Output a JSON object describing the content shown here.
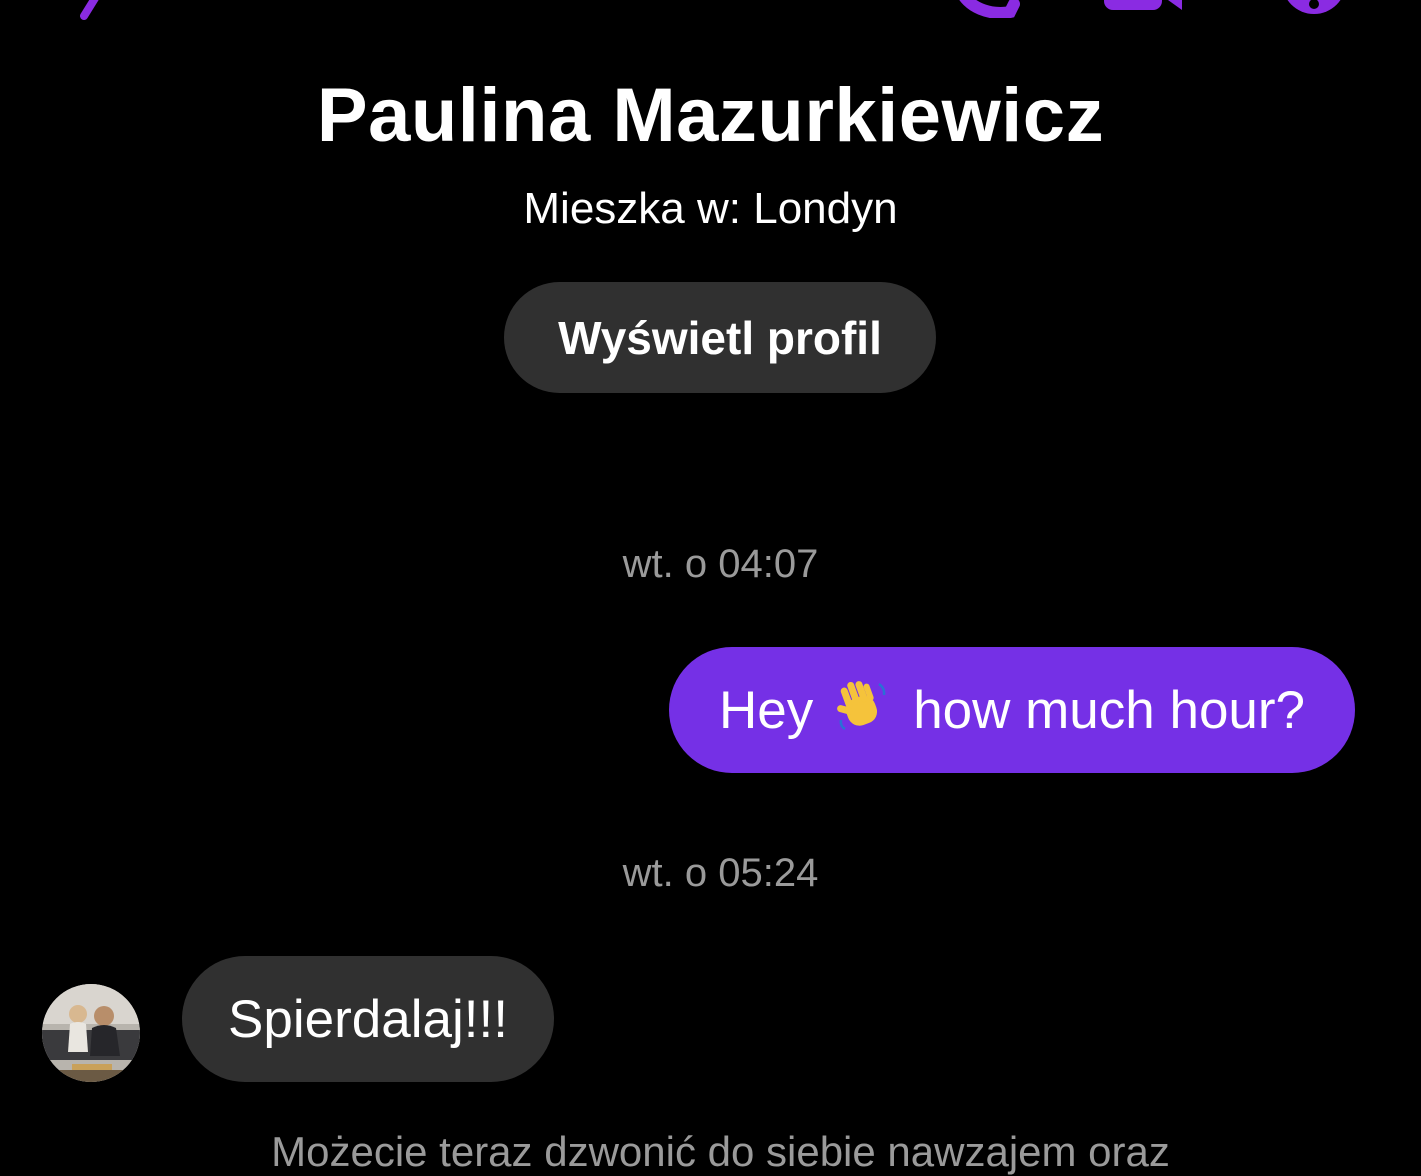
{
  "colors": {
    "accent": "#7530e6",
    "icon": "#8a2be2",
    "background": "#000000",
    "incoming_bubble": "#303030",
    "muted_text": "#9a9a9a"
  },
  "header": {
    "icons": [
      "back-icon",
      "phone-call-icon",
      "video-call-icon",
      "info-icon"
    ]
  },
  "profile": {
    "name": "Paulina Mazurkiewicz",
    "subtitle": "Mieszka w: Londyn",
    "view_profile_label": "Wyświetl profil"
  },
  "messages": [
    {
      "timestamp": "wt. o 04:07",
      "direction": "outgoing",
      "text_before": "Hey",
      "emoji": "waving-hand-icon",
      "text_after": "how much hour?"
    },
    {
      "timestamp": "wt. o 05:24",
      "direction": "incoming",
      "text": "Spierdalaj!!!",
      "avatar": "contact-avatar"
    }
  ],
  "footer_notice": "Możecie teraz dzwonić do siebie nawzajem oraz"
}
